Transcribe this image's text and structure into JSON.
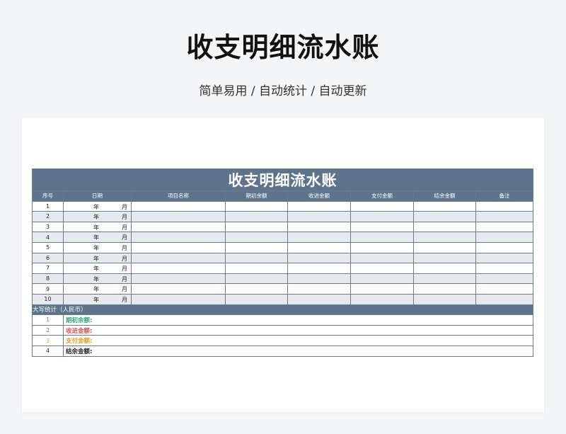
{
  "page": {
    "title": "收支明细流水账",
    "subtitle": "简单易用  /  自动统计  /  自动更新"
  },
  "sheet": {
    "title": "收支明细流水账",
    "headers": [
      "序号",
      "日期",
      "项目名称",
      "期初余额",
      "收进金额",
      "支付金额",
      "结余金额",
      "备注"
    ],
    "rows": [
      {
        "no": "1",
        "year": "年",
        "month": "月"
      },
      {
        "no": "2",
        "year": "年",
        "month": "月"
      },
      {
        "no": "3",
        "year": "年",
        "month": "月"
      },
      {
        "no": "4",
        "year": "年",
        "month": "月"
      },
      {
        "no": "5",
        "year": "年",
        "month": "月"
      },
      {
        "no": "6",
        "year": "年",
        "month": "月"
      },
      {
        "no": "7",
        "year": "年",
        "month": "月"
      },
      {
        "no": "8",
        "year": "年",
        "month": "月"
      },
      {
        "no": "9",
        "year": "年",
        "month": "月"
      },
      {
        "no": "10",
        "year": "年",
        "month": "月"
      }
    ],
    "summary_title": "大写统计（人民币）",
    "summary": [
      {
        "no": "1",
        "label": "期初余额:",
        "color": "#3aa57a"
      },
      {
        "no": "2",
        "label": "收进金额:",
        "color": "#d9534f"
      },
      {
        "no": "3",
        "label": "支付金额:",
        "color": "#e0a020"
      },
      {
        "no": "4",
        "label": "结余金额:",
        "color": "#222222"
      }
    ],
    "colors": {
      "header_bg": "#5e748c",
      "stripe": "#e6e9ee"
    }
  }
}
